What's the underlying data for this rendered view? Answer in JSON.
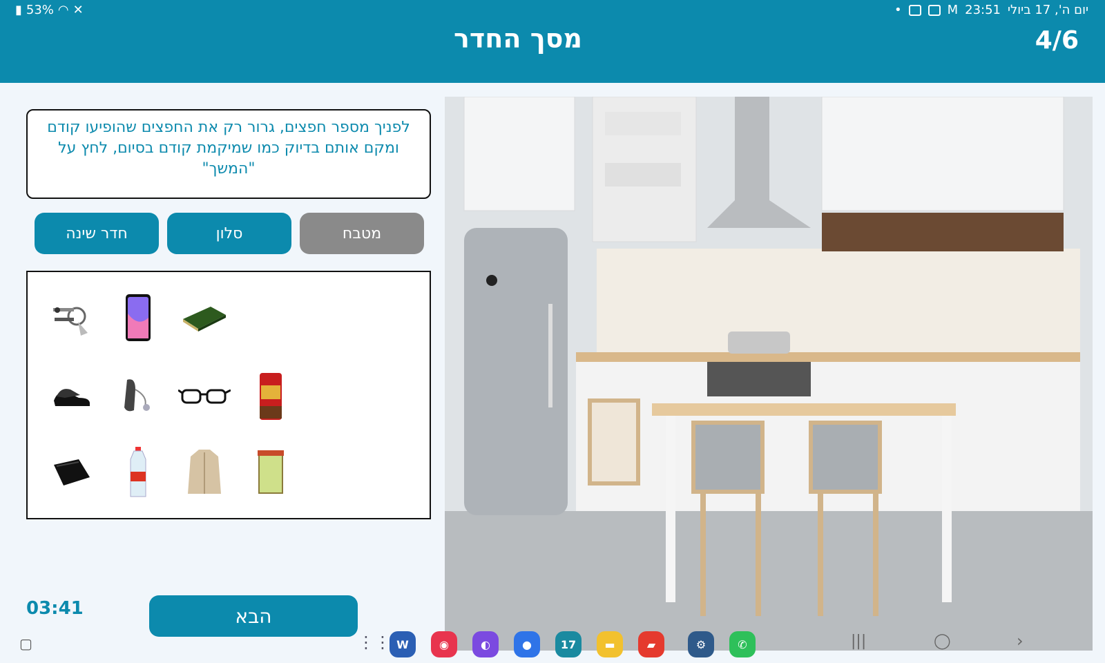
{
  "status_bar": {
    "battery": "53%",
    "time": "23:51",
    "date": "יום ה', 17 ביולי"
  },
  "header": {
    "title": "מסך החדר",
    "progress": "4/6"
  },
  "instructions": "לפניך מספר חפצים, גרור רק את החפצים שהופיעו קודם ומקם אותם בדיוק כמו שמיקמת קודם בסיום, לחץ על \"המשך\"",
  "room_tabs": [
    {
      "label": "חדר שינה",
      "selected": false
    },
    {
      "label": "סלון",
      "selected": false
    },
    {
      "label": "מטבח",
      "selected": true
    }
  ],
  "items": [
    {
      "icon": "keys-icon"
    },
    {
      "icon": "smartphone-icon"
    },
    {
      "icon": "book-icon"
    },
    {
      "icon": "shoes-icon"
    },
    {
      "icon": "hearing-aid-icon"
    },
    {
      "icon": "glasses-icon"
    },
    {
      "icon": "spice-jar-icon"
    },
    {
      "icon": "wallet-icon"
    },
    {
      "icon": "water-bottle-icon"
    },
    {
      "icon": "coat-icon"
    },
    {
      "icon": "tea-box-icon"
    }
  ],
  "timer": "03:41",
  "next_button": "הבא",
  "taskbar_apps": [
    "apps-grid-icon",
    "word-icon",
    "camera-icon",
    "browser-icon",
    "messages-icon",
    "calendar-icon",
    "files-icon",
    "notes-icon",
    "settings-icon",
    "whatsapp-icon"
  ],
  "calendar_day": "17",
  "word_letter": "W",
  "colors": {
    "accent": "#0c8aad",
    "selected_tab": "#8a8a8a",
    "background": "#f1f6fb"
  }
}
